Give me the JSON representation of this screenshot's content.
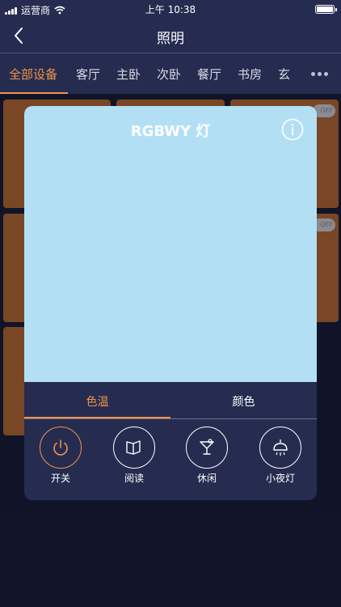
{
  "status_bar": {
    "carrier": "运营商",
    "time": "上午 10:38"
  },
  "nav": {
    "title": "照明",
    "back_icon": "chevron-left-icon"
  },
  "room_tabs": [
    {
      "label": "全部设备",
      "active": true
    },
    {
      "label": "客厅",
      "active": false
    },
    {
      "label": "主卧",
      "active": false
    },
    {
      "label": "次卧",
      "active": false
    },
    {
      "label": "餐厅",
      "active": false
    },
    {
      "label": "书房",
      "active": false
    },
    {
      "label": "玄",
      "active": false
    }
  ],
  "device_cards": {
    "off_label": "OFF"
  },
  "modal": {
    "title": "RGBWY 灯",
    "info_icon": "info-icon",
    "preview_color": "#b3dff5",
    "mode_tabs": [
      {
        "label": "色温",
        "active": true
      },
      {
        "label": "颜色",
        "active": false
      }
    ],
    "scenes": [
      {
        "label": "开关",
        "icon": "power-icon",
        "active": true
      },
      {
        "label": "阅读",
        "icon": "book-icon",
        "active": false
      },
      {
        "label": "休闲",
        "icon": "cocktail-icon",
        "active": false
      },
      {
        "label": "小夜灯",
        "icon": "lamp-icon",
        "active": false
      }
    ]
  },
  "colors": {
    "accent": "#f0934a",
    "header_bg": "#262c50",
    "page_bg": "#161a2e",
    "card_bg": "#b6682b"
  }
}
